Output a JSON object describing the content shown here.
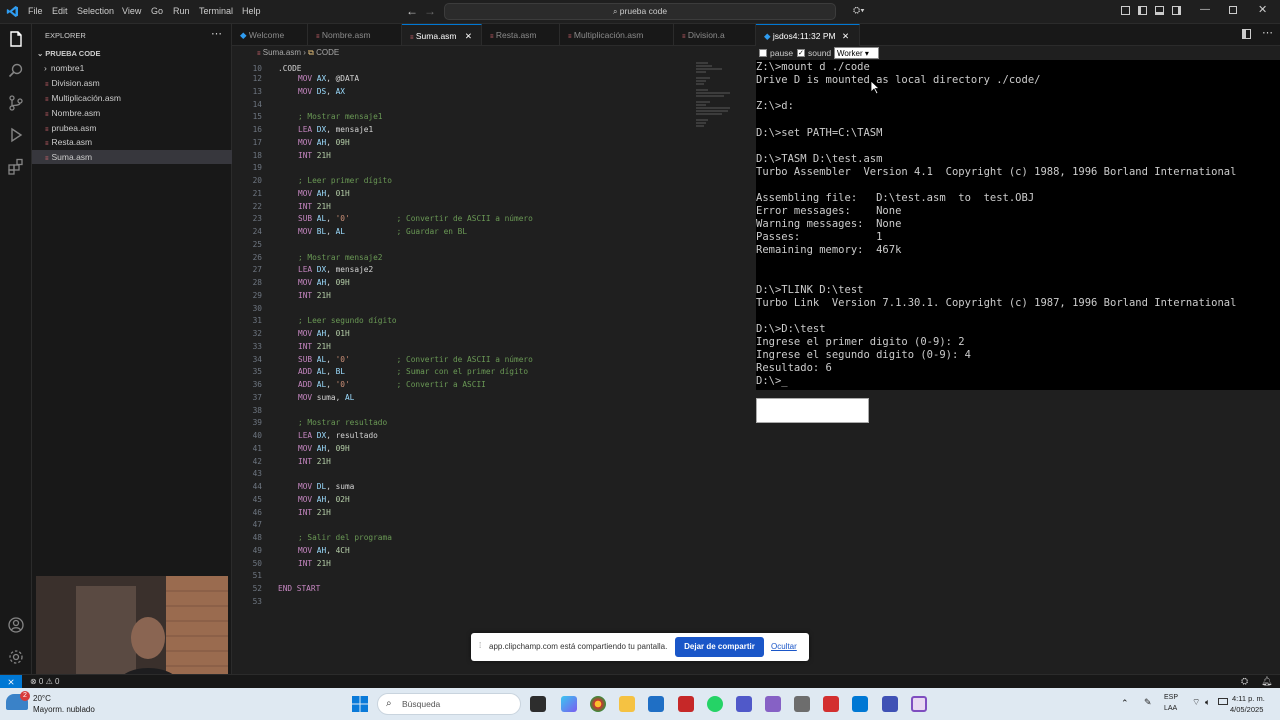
{
  "menu": [
    "File",
    "Edit",
    "Selection",
    "View",
    "Go",
    "Run",
    "Terminal",
    "Help"
  ],
  "search_label": "prueba code",
  "sidebar": {
    "title": "EXPLORER",
    "folder": "PRUEBA CODE",
    "items": [
      "nombre1",
      "Division.asm",
      "Multiplicación.asm",
      "Nombre.asm",
      "prubea.asm",
      "Resta.asm",
      "Suma.asm"
    ]
  },
  "editor": {
    "tabs": [
      "Welcome",
      "Nombre.asm",
      "Suma.asm",
      "Resta.asm",
      "Multiplicación.asm",
      "Division.a"
    ],
    "breadcrumb_file": "Suma.asm",
    "breadcrumb_symbol": "CODE",
    "header_line_no": "10",
    "header_line": ".CODE",
    "lines": [
      {
        "n": "12",
        "t": "MOV AX, @DATA"
      },
      {
        "n": "13",
        "t": "MOV DS, AX"
      },
      {
        "n": "14",
        "t": ""
      },
      {
        "n": "15",
        "t": "; Mostrar mensaje1"
      },
      {
        "n": "16",
        "t": "LEA DX, mensaje1"
      },
      {
        "n": "17",
        "t": "MOV AH, 09H"
      },
      {
        "n": "18",
        "t": "INT 21H"
      },
      {
        "n": "19",
        "t": ""
      },
      {
        "n": "20",
        "t": "; Leer primer dígito"
      },
      {
        "n": "21",
        "t": "MOV AH, 01H"
      },
      {
        "n": "22",
        "t": "INT 21H"
      },
      {
        "n": "23",
        "t": "SUB AL, '0'          ; Convertir de ASCII a número"
      },
      {
        "n": "24",
        "t": "MOV BL, AL           ; Guardar en BL"
      },
      {
        "n": "25",
        "t": ""
      },
      {
        "n": "26",
        "t": "; Mostrar mensaje2"
      },
      {
        "n": "27",
        "t": "LEA DX, mensaje2"
      },
      {
        "n": "28",
        "t": "MOV AH, 09H"
      },
      {
        "n": "29",
        "t": "INT 21H"
      },
      {
        "n": "30",
        "t": ""
      },
      {
        "n": "31",
        "t": "; Leer segundo dígito"
      },
      {
        "n": "32",
        "t": "MOV AH, 01H"
      },
      {
        "n": "33",
        "t": "INT 21H"
      },
      {
        "n": "34",
        "t": "SUB AL, '0'          ; Convertir de ASCII a número"
      },
      {
        "n": "35",
        "t": "ADD AL, BL           ; Sumar con el primer dígito"
      },
      {
        "n": "36",
        "t": "ADD AL, '0'          ; Convertir a ASCII"
      },
      {
        "n": "37",
        "t": "MOV suma, AL"
      },
      {
        "n": "38",
        "t": ""
      },
      {
        "n": "39",
        "t": "; Mostrar resultado"
      },
      {
        "n": "40",
        "t": "LEA DX, resultado"
      },
      {
        "n": "41",
        "t": "MOV AH, 09H"
      },
      {
        "n": "42",
        "t": "INT 21H"
      },
      {
        "n": "43",
        "t": ""
      },
      {
        "n": "44",
        "t": "MOV DL, suma"
      },
      {
        "n": "45",
        "t": "MOV AH, 02H"
      },
      {
        "n": "46",
        "t": "INT 21H"
      },
      {
        "n": "47",
        "t": ""
      },
      {
        "n": "48",
        "t": "; Salir del programa"
      },
      {
        "n": "49",
        "t": "MOV AH, 4CH"
      },
      {
        "n": "50",
        "t": "INT 21H"
      },
      {
        "n": "51",
        "t": ""
      },
      {
        "n": "52",
        "t": "END START"
      },
      {
        "n": "53",
        "t": ""
      }
    ]
  },
  "dosbox": {
    "tab_label": "jsdos4:11:32 PM",
    "pause_label": "pause",
    "sound_label": "sound",
    "mode_select": "Worker",
    "lines": [
      "Z:\\>mount d ./code",
      "Drive D is mounted as local directory ./code/",
      "",
      "Z:\\>d:",
      "",
      "D:\\>set PATH=C:\\TASM",
      "",
      "D:\\>TASM D:\\test.asm",
      "Turbo Assembler  Version 4.1  Copyright (c) 1988, 1996 Borland International",
      "",
      "Assembling file:   D:\\test.asm  to  test.OBJ",
      "Error messages:    None",
      "Warning messages:  None",
      "Passes:            1",
      "Remaining memory:  467k",
      "",
      "",
      "D:\\>TLINK D:\\test",
      "Turbo Link  Version 7.1.30.1. Copyright (c) 1987, 1996 Borland International",
      "",
      "D:\\>D:\\test",
      "Ingrese el primer digito (0-9): 2",
      "Ingrese el segundo digito (0-9): 4",
      "Resultado: 6",
      "D:\\>_"
    ]
  },
  "share_bar": {
    "message": "app.clipchamp.com está compartiendo tu pantalla.",
    "stop_label": "Dejar de compartir",
    "hide_label": "Ocultar"
  },
  "taskbar": {
    "weather_temp": "20°C",
    "weather_desc": "Mayorm. nublado",
    "notification_count": "2",
    "search_placeholder": "Búsqueda",
    "lang_top": "ESP",
    "lang_bottom": "LAA",
    "time": "4:11 p. m.",
    "date": "4/05/2025"
  },
  "colors": {
    "accent": "#0078d4",
    "editor_bg": "#1f1f1f",
    "sidebar_bg": "#181818",
    "comment": "#6a9955",
    "keyword": "#c586c0",
    "register": "#9cdcfe",
    "dos_bg": "#000000"
  }
}
